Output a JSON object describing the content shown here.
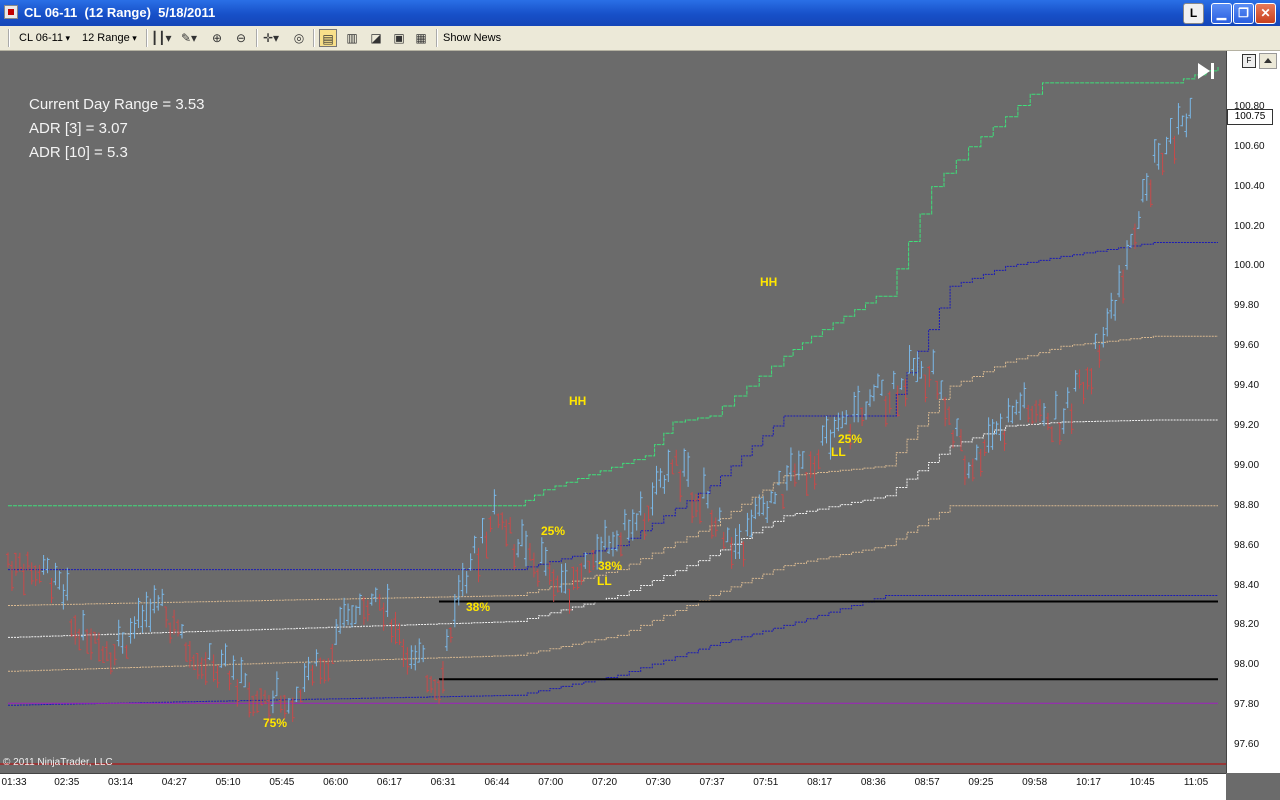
{
  "window": {
    "title": "CL 06-11  (12 Range)  5/18/2011",
    "buttons": {
      "link": "L"
    }
  },
  "toolbar": {
    "instrument": "CL 06-11",
    "period": "12 Range",
    "show_news": "Show News"
  },
  "stats": {
    "current_day_range": "Current Day Range = 3.53",
    "adr_3": "ADR [3] = 3.07",
    "adr_10": "ADR [10] = 5.3"
  },
  "annotations": [
    {
      "text": "HH",
      "kind": "swing-high"
    },
    {
      "text": "HH",
      "kind": "swing-high"
    },
    {
      "text": "25%",
      "kind": "retracement"
    },
    {
      "text": "38%",
      "kind": "retracement"
    },
    {
      "text": "LL",
      "kind": "swing-low"
    },
    {
      "text": "38%",
      "kind": "retracement"
    },
    {
      "text": "25%",
      "kind": "retracement"
    },
    {
      "text": "LL",
      "kind": "swing-low"
    },
    {
      "text": "75%",
      "kind": "retracement"
    }
  ],
  "last_price": "100.75",
  "copyright": "© 2011 NinjaTrader, LLC",
  "price_axis_button": "F",
  "chart_data": {
    "type": "line",
    "title": "",
    "xlabel": "",
    "ylabel": "",
    "ylim": [
      97.46,
      101.08
    ],
    "y_ticks": [
      "100.80",
      "100.60",
      "100.40",
      "100.20",
      "100.00",
      "99.80",
      "99.60",
      "99.40",
      "99.20",
      "99.00",
      "98.80",
      "98.60",
      "98.40",
      "98.20",
      "98.00",
      "97.80",
      "97.60"
    ],
    "x_ticks": [
      "01:33",
      "02:35",
      "03:14",
      "04:27",
      "05:10",
      "05:45",
      "06:00",
      "06:17",
      "06:31",
      "06:44",
      "07:00",
      "07:20",
      "07:30",
      "07:37",
      "07:51",
      "08:17",
      "08:36",
      "08:57",
      "09:25",
      "09:58",
      "10:17",
      "10:45",
      "11:05"
    ],
    "grid": false,
    "colors": {
      "background": "#6b6b6b",
      "up_bar": "#7ab8e8",
      "down_bar": "#c84a4a",
      "high_line": "#3ee07a",
      "blue_band": "#1a1ab8",
      "tan_band": "#d8b890",
      "white_band": "#f0f0f0",
      "purple_line": "#a020c0",
      "support_lines": "#000000",
      "annotation": "#ffe600"
    },
    "price_series": {
      "name": "",
      "x_index": [
        0,
        5,
        8,
        12,
        17,
        20,
        24,
        30,
        33,
        40,
        44,
        47,
        48,
        50,
        53,
        55,
        60,
        64,
        70,
        72,
        77,
        79,
        85,
        90,
        94,
        100,
        104,
        110,
        114,
        120,
        124,
        128
      ],
      "close": [
        98.55,
        98.45,
        98.15,
        98.1,
        98.3,
        98.05,
        97.95,
        97.8,
        97.95,
        98.4,
        98.0,
        97.95,
        98.2,
        98.5,
        98.8,
        98.6,
        98.4,
        98.55,
        98.8,
        99.05,
        98.7,
        98.6,
        98.95,
        99.15,
        99.35,
        99.5,
        99.0,
        99.3,
        99.2,
        99.8,
        100.5,
        100.75
      ]
    },
    "series": [
      {
        "name": "",
        "values_x": [
          0,
          55,
          58,
          69,
          72,
          76,
          80,
          84,
          87,
          94,
          95,
          100,
          104,
          108,
          112,
          126,
          131
        ],
        "values": [
          98.8,
          98.8,
          98.88,
          99.05,
          99.22,
          99.25,
          99.4,
          99.55,
          99.65,
          99.85,
          99.85,
          100.4,
          100.6,
          100.75,
          100.92,
          100.92,
          101.0
        ]
      },
      {
        "name": "",
        "values_x": [
          0,
          55,
          66,
          76,
          84,
          95,
          102,
          108,
          114,
          124,
          131
        ],
        "values": [
          98.48,
          98.48,
          98.6,
          98.9,
          99.25,
          99.25,
          99.9,
          100.0,
          100.05,
          100.12,
          100.12
        ]
      },
      {
        "name": "",
        "values_x": [
          0,
          55,
          66,
          76,
          84,
          95,
          102,
          108,
          114,
          124,
          131
        ],
        "values": [
          98.3,
          98.35,
          98.48,
          98.7,
          98.95,
          99.0,
          99.4,
          99.52,
          99.6,
          99.65,
          99.65
        ]
      },
      {
        "name": "",
        "values_x": [
          0,
          55,
          66,
          76,
          84,
          95,
          102,
          108,
          114,
          124,
          131
        ],
        "values": [
          98.14,
          98.22,
          98.35,
          98.55,
          98.75,
          98.85,
          99.1,
          99.2,
          99.22,
          99.23,
          99.23
        ]
      },
      {
        "name": "",
        "values_x": [
          0,
          55,
          66,
          76,
          84,
          95,
          102,
          108,
          114,
          124,
          131
        ],
        "values": [
          97.97,
          98.05,
          98.15,
          98.35,
          98.5,
          98.6,
          98.8,
          98.8,
          98.8,
          98.8,
          98.8
        ]
      },
      {
        "name": "",
        "values_x": [
          0,
          55,
          66,
          76,
          84,
          95,
          102,
          108,
          114,
          124,
          131
        ],
        "values": [
          97.8,
          97.85,
          97.95,
          98.1,
          98.2,
          98.35,
          98.35,
          98.35,
          98.35,
          98.35,
          98.35
        ]
      },
      {
        "name": "",
        "values_x": [
          0,
          131
        ],
        "values": [
          97.81,
          97.81
        ]
      },
      {
        "name": "",
        "values_x": [
          38,
          131
        ],
        "values": [
          98.32,
          98.32
        ]
      },
      {
        "name": "",
        "values_x": [
          38,
          131
        ],
        "values": [
          97.93,
          97.93
        ]
      }
    ]
  }
}
